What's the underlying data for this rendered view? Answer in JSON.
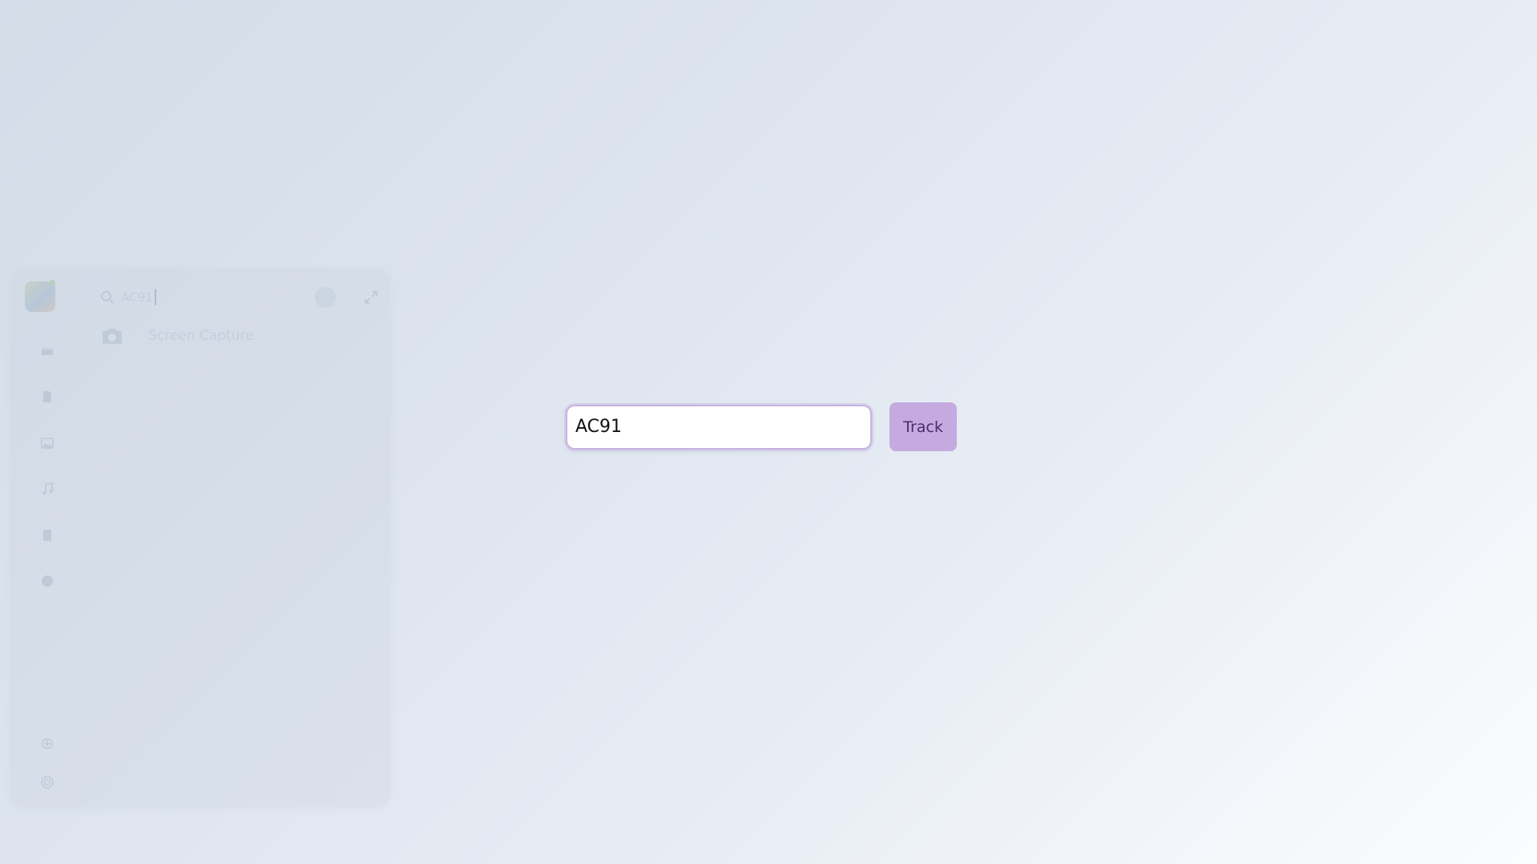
{
  "launcher": {
    "search": {
      "query": "AC91",
      "search_icon": "search-icon",
      "clear_icon": "clear-icon",
      "expand_icon": "expand-icon"
    },
    "results": [
      {
        "label": "Screen Capture",
        "icon": "camera-icon"
      }
    ],
    "rail_icons": [
      "window-icon",
      "document-icon",
      "image-icon",
      "music-icon",
      "file-icon",
      "info-icon",
      "plugin-icon",
      "power-icon"
    ]
  },
  "tracker": {
    "input_value": "AC91",
    "button_label": "Track",
    "accent_color": "#c4aadf",
    "button_text_color": "#4a2a6e"
  }
}
